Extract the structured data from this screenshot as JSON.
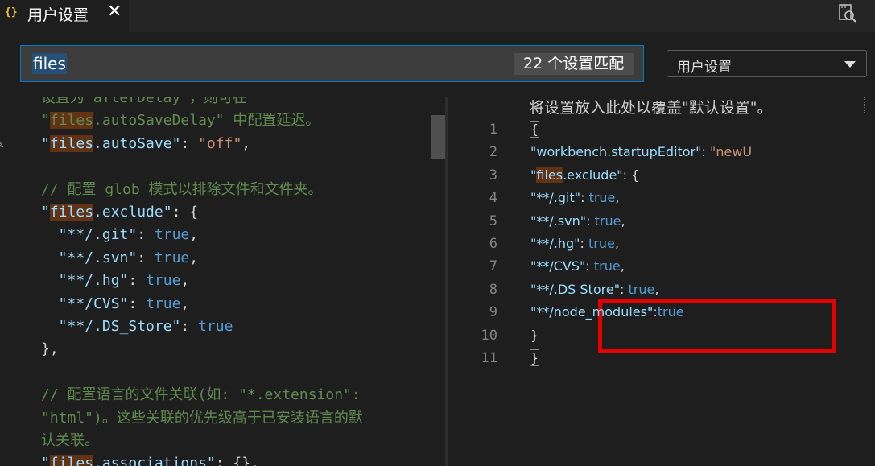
{
  "tab": {
    "icon": "{}",
    "icon_name": "json-braces-icon",
    "title": "用户设置",
    "close_glyph": "✕"
  },
  "toolbar": {
    "open_settings_icon": "open-settings-file-icon"
  },
  "search": {
    "value": "files",
    "result_count": "22 个设置匹配"
  },
  "scope_select": {
    "selected": "用户设置"
  },
  "left_pane": {
    "lines": [
      [
        {
          "t": "设置为\"afterDelay\"，则可在",
          "c": "cm"
        }
      ],
      [
        {
          "t": "\"",
          "c": "cm"
        },
        {
          "t": "files",
          "c": "cm",
          "hl": true
        },
        {
          "t": ".autoSaveDelay\" 中配置延迟。",
          "c": "cm"
        }
      ],
      [
        {
          "t": "\"",
          "c": "key"
        },
        {
          "t": "files",
          "c": "key",
          "hl": true
        },
        {
          "t": ".autoSave\"",
          "c": "key"
        },
        {
          "t": ": ",
          "c": "pun"
        },
        {
          "t": "\"off\"",
          "c": "str"
        },
        {
          "t": ",",
          "c": "pun"
        }
      ],
      [],
      [
        {
          "t": "// 配置 glob 模式以排除文件和文件夹。",
          "c": "cm"
        }
      ],
      [
        {
          "t": "\"",
          "c": "key"
        },
        {
          "t": "files",
          "c": "key",
          "hl": true
        },
        {
          "t": ".exclude\"",
          "c": "key"
        },
        {
          "t": ": {",
          "c": "pun"
        }
      ],
      [
        {
          "t": "  \"**/.git\"",
          "c": "key"
        },
        {
          "t": ": ",
          "c": "pun"
        },
        {
          "t": "true",
          "c": "kw"
        },
        {
          "t": ",",
          "c": "pun"
        }
      ],
      [
        {
          "t": "  \"**/.svn\"",
          "c": "key"
        },
        {
          "t": ": ",
          "c": "pun"
        },
        {
          "t": "true",
          "c": "kw"
        },
        {
          "t": ",",
          "c": "pun"
        }
      ],
      [
        {
          "t": "  \"**/.hg\"",
          "c": "key"
        },
        {
          "t": ": ",
          "c": "pun"
        },
        {
          "t": "true",
          "c": "kw"
        },
        {
          "t": ",",
          "c": "pun"
        }
      ],
      [
        {
          "t": "  \"**/CVS\"",
          "c": "key"
        },
        {
          "t": ": ",
          "c": "pun"
        },
        {
          "t": "true",
          "c": "kw"
        },
        {
          "t": ",",
          "c": "pun"
        }
      ],
      [
        {
          "t": "  \"**/.DS_Store\"",
          "c": "key"
        },
        {
          "t": ": ",
          "c": "pun"
        },
        {
          "t": "true",
          "c": "kw"
        }
      ],
      [
        {
          "t": "},",
          "c": "pun"
        }
      ],
      [],
      [
        {
          "t": "// 配置语言的文件关联(如: \"*.extension\":",
          "c": "cm"
        }
      ],
      [
        {
          "t": "\"html\")。这些关联的优先级高于已安装语言的默",
          "c": "cm"
        }
      ],
      [
        {
          "t": "认关联。",
          "c": "cm"
        }
      ],
      [
        {
          "t": "\"",
          "c": "key"
        },
        {
          "t": "files",
          "c": "key",
          "hl": true
        },
        {
          "t": ".associations\"",
          "c": "key"
        },
        {
          "t": ": {},",
          "c": "pun"
        }
      ]
    ]
  },
  "right_pane": {
    "header": "将设置放入此处以覆盖\"默认设置\"。",
    "line_numbers": [
      "1",
      "2",
      "3",
      "4",
      "5",
      "6",
      "7",
      "8",
      "9",
      "10",
      "11"
    ],
    "lines": [
      [
        {
          "t": "{",
          "c": "pun",
          "box": true
        }
      ],
      [
        {
          "t": "    \"workbench.startupEditor\"",
          "c": "key"
        },
        {
          "t": ": ",
          "c": "pun"
        },
        {
          "t": "\"newU",
          "c": "str"
        }
      ],
      [
        {
          "t": "    \"",
          "c": "key"
        },
        {
          "t": "files",
          "c": "key",
          "hl": true
        },
        {
          "t": ".exclude\"",
          "c": "key"
        },
        {
          "t": ": {",
          "c": "pun"
        }
      ],
      [
        {
          "t": "        \"**/.git\"",
          "c": "key"
        },
        {
          "t": ": ",
          "c": "pun"
        },
        {
          "t": "true",
          "c": "kw"
        },
        {
          "t": ",",
          "c": "pun"
        }
      ],
      [
        {
          "t": "        \"**/.svn\"",
          "c": "key"
        },
        {
          "t": ": ",
          "c": "pun"
        },
        {
          "t": "true",
          "c": "kw"
        },
        {
          "t": ",",
          "c": "pun"
        }
      ],
      [
        {
          "t": "        \"**/.hg\"",
          "c": "key"
        },
        {
          "t": ": ",
          "c": "pun"
        },
        {
          "t": "true",
          "c": "kw"
        },
        {
          "t": ",",
          "c": "pun"
        }
      ],
      [
        {
          "t": "        \"**/CVS\"",
          "c": "key"
        },
        {
          "t": ": ",
          "c": "pun"
        },
        {
          "t": "true",
          "c": "kw"
        },
        {
          "t": ",",
          "c": "pun"
        }
      ],
      [
        {
          "t": "        \"**/.DS Store\"",
          "c": "key"
        },
        {
          "t": ": ",
          "c": "pun"
        },
        {
          "t": "true",
          "c": "kw"
        },
        {
          "t": ",",
          "c": "pun"
        }
      ],
      [
        {
          "t": "        \"**/node_modules\"",
          "c": "key"
        },
        {
          "t": ":",
          "c": "pun"
        },
        {
          "t": "true",
          "c": "kw"
        }
      ],
      [
        {
          "t": "    }",
          "c": "pun"
        }
      ],
      [
        {
          "t": "}",
          "c": "pun",
          "box": true
        }
      ]
    ]
  },
  "colors": {
    "accent": "#007acc",
    "annotation_box": "#e50000",
    "match_highlight": "#613214"
  }
}
